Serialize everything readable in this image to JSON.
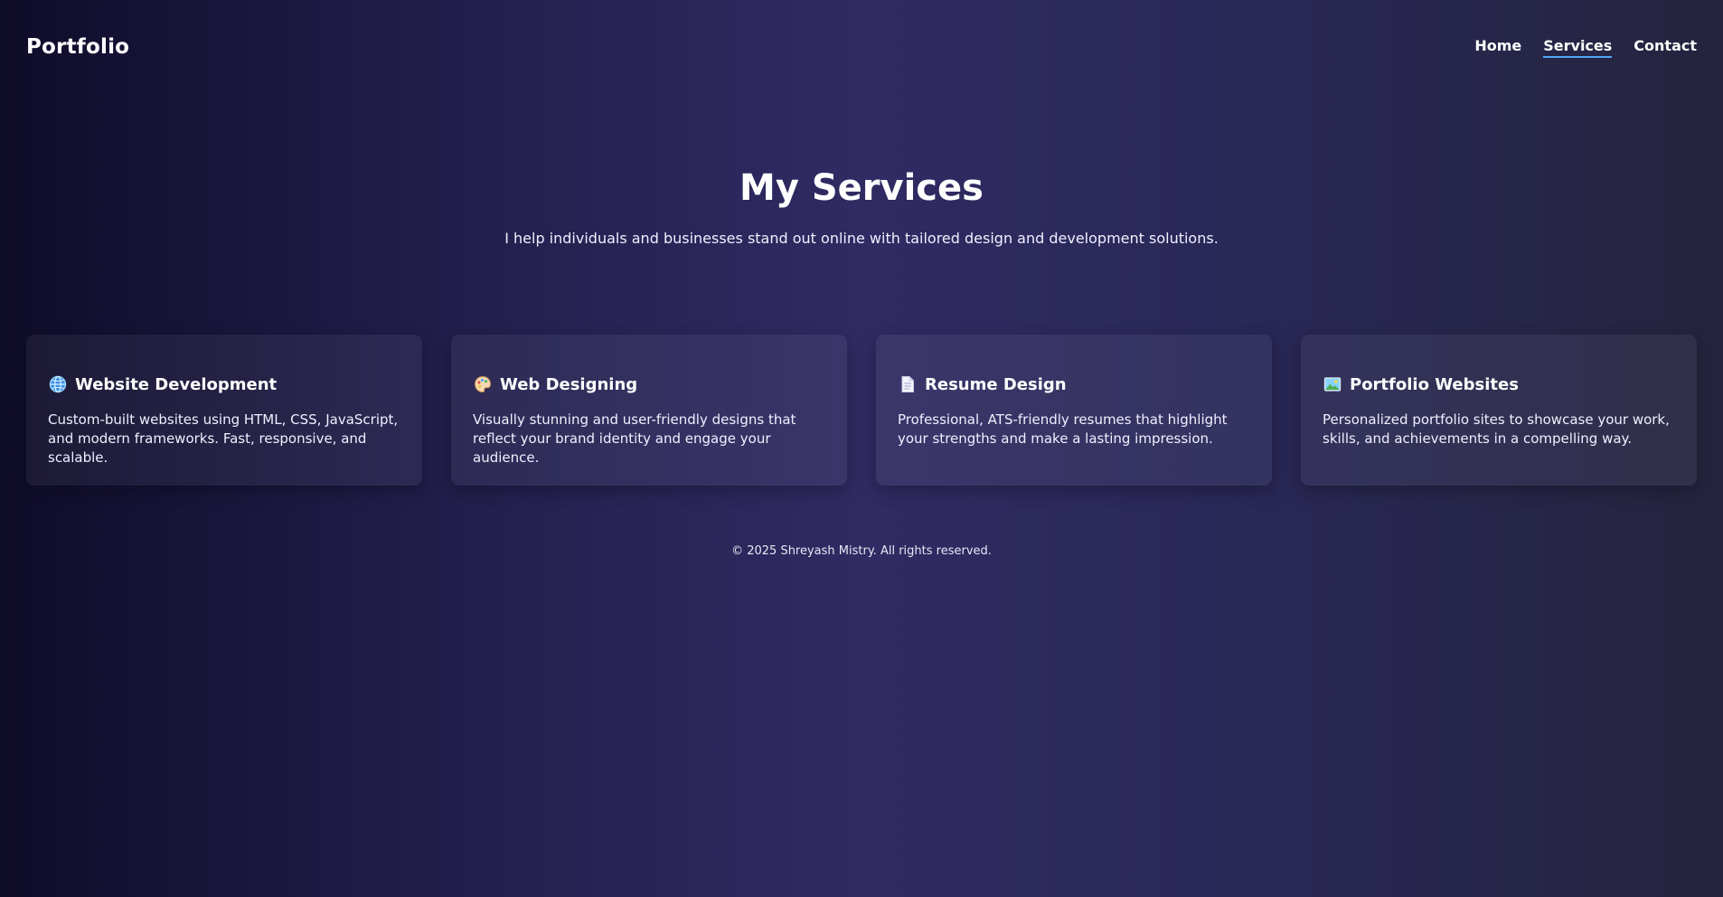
{
  "navbar": {
    "logo": "Portfolio",
    "links": [
      {
        "label": "Home",
        "active": false
      },
      {
        "label": "Services",
        "active": true
      },
      {
        "label": "Contact",
        "active": false
      }
    ]
  },
  "hero": {
    "title": "My Services",
    "subtitle": "I help individuals and businesses stand out online with tailored design and development solutions."
  },
  "services": [
    {
      "icon": "globe-icon",
      "title": "Website Development",
      "description": "Custom-built websites using HTML, CSS, JavaScript, and modern frameworks. Fast, responsive, and scalable."
    },
    {
      "icon": "palette-icon",
      "title": "Web Designing",
      "description": "Visually stunning and user-friendly designs that reflect your brand identity and engage your audience."
    },
    {
      "icon": "document-icon",
      "title": "Resume Design",
      "description": "Professional, ATS-friendly resumes that highlight your strengths and make a lasting impression."
    },
    {
      "icon": "picture-icon",
      "title": "Portfolio Websites",
      "description": "Personalized portfolio sites to showcase your work, skills, and achievements in a compelling way."
    }
  ],
  "footer": {
    "text": "© 2025 Shreyash Mistry. All rights reserved."
  },
  "colors": {
    "background_start": "#0f0c29",
    "background_mid": "#302b63",
    "background_end": "#24243e",
    "active_underline": "#4ea8f5",
    "text": "#ffffff"
  }
}
